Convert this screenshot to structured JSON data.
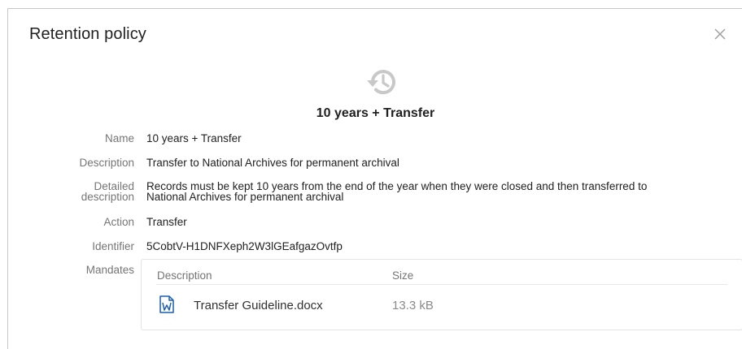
{
  "dialog": {
    "title": "Retention policy",
    "close_icon": "close-icon"
  },
  "hero": {
    "icon": "history-icon",
    "title": "10 years + Transfer"
  },
  "fields": {
    "name": {
      "label": "Name",
      "value": "10 years + Transfer"
    },
    "description": {
      "label": "Description",
      "value": "Transfer to National Archives for permanent archival"
    },
    "detailed_description": {
      "label_line1": "Detailed",
      "label_line2": "description",
      "value_line1": "Records must be kept 10 years from the end of the year when they were closed and then transferred to",
      "value_line2": "National Archives for permanent archival"
    },
    "action": {
      "label": "Action",
      "value": "Transfer"
    },
    "identifier": {
      "label": "Identifier",
      "value": "5CobtV-H1DNFXeph2W3lGEafgazOvtfp"
    },
    "mandates": {
      "label": "Mandates"
    }
  },
  "mandates": {
    "columns": {
      "description": "Description",
      "size": "Size"
    },
    "rows": [
      {
        "icon": "word-document-icon",
        "name": "Transfer Guideline.docx",
        "size": "13.3 kB"
      }
    ]
  },
  "colors": {
    "label": "#757575",
    "text": "#212121",
    "icon_blue": "#1a5fb4",
    "hero_icon": "#c8c8c8"
  }
}
